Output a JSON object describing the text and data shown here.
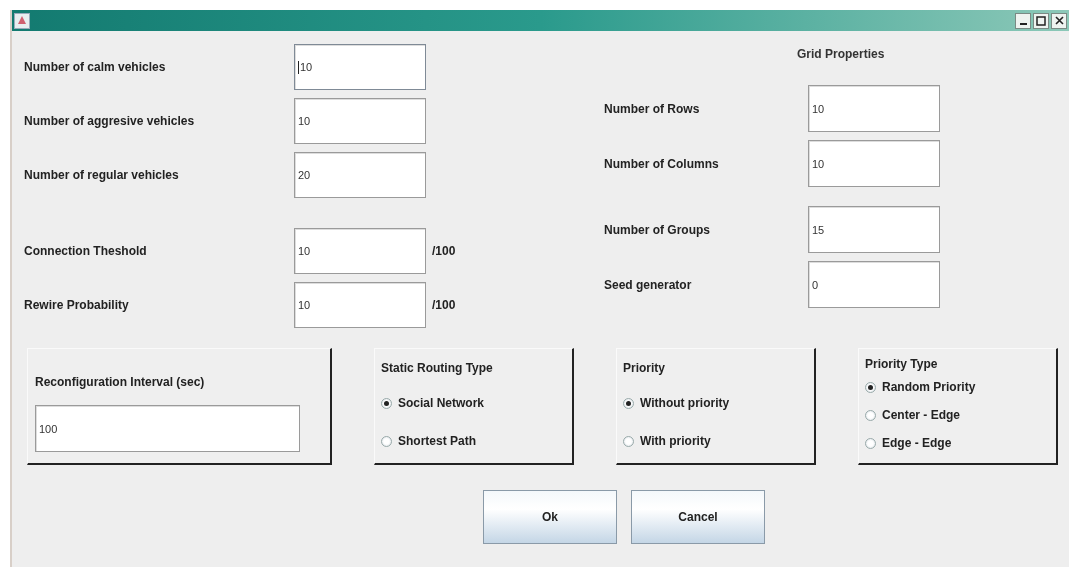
{
  "vehicle_counts": [
    {
      "label": "Number of calm vehicles",
      "value": "10",
      "focused": true
    },
    {
      "label": "Number of aggresive vehicles",
      "value": "10",
      "focused": false
    },
    {
      "label": "Number of regular vehicles",
      "value": "20",
      "focused": false
    }
  ],
  "network_parameters": [
    {
      "label": "Connection Theshold",
      "value": "10",
      "unit": "/100"
    },
    {
      "label": "Rewire Probability",
      "value": "10",
      "unit": "/100"
    }
  ],
  "grid_properties": {
    "heading": "Grid Properties",
    "size_fields": [
      {
        "label": "Number of Rows",
        "value": "10"
      },
      {
        "label": "Number of Columns",
        "value": "10"
      }
    ],
    "other_fields": [
      {
        "label": "Number of Groups",
        "value": "15"
      },
      {
        "label": "Seed generator",
        "value": "0"
      }
    ]
  },
  "panels": [
    {
      "kind": "field",
      "title": "Reconfiguration Interval (sec)",
      "value": "100"
    },
    {
      "kind": "radio",
      "title": "Static Routing Type",
      "options": [
        {
          "label": "Social Network",
          "selected": true
        },
        {
          "label": "Shortest Path",
          "selected": false
        }
      ]
    },
    {
      "kind": "radio",
      "title": "Priority",
      "options": [
        {
          "label": "Without priority",
          "selected": true
        },
        {
          "label": "With priority",
          "selected": false
        }
      ]
    },
    {
      "kind": "radio",
      "title": "Priority Type",
      "options": [
        {
          "label": "Random Priority",
          "selected": true
        },
        {
          "label": "Center - Edge",
          "selected": false
        },
        {
          "label": "Edge - Edge",
          "selected": false
        }
      ]
    }
  ],
  "buttons": [
    "Ok",
    "Cancel"
  ]
}
